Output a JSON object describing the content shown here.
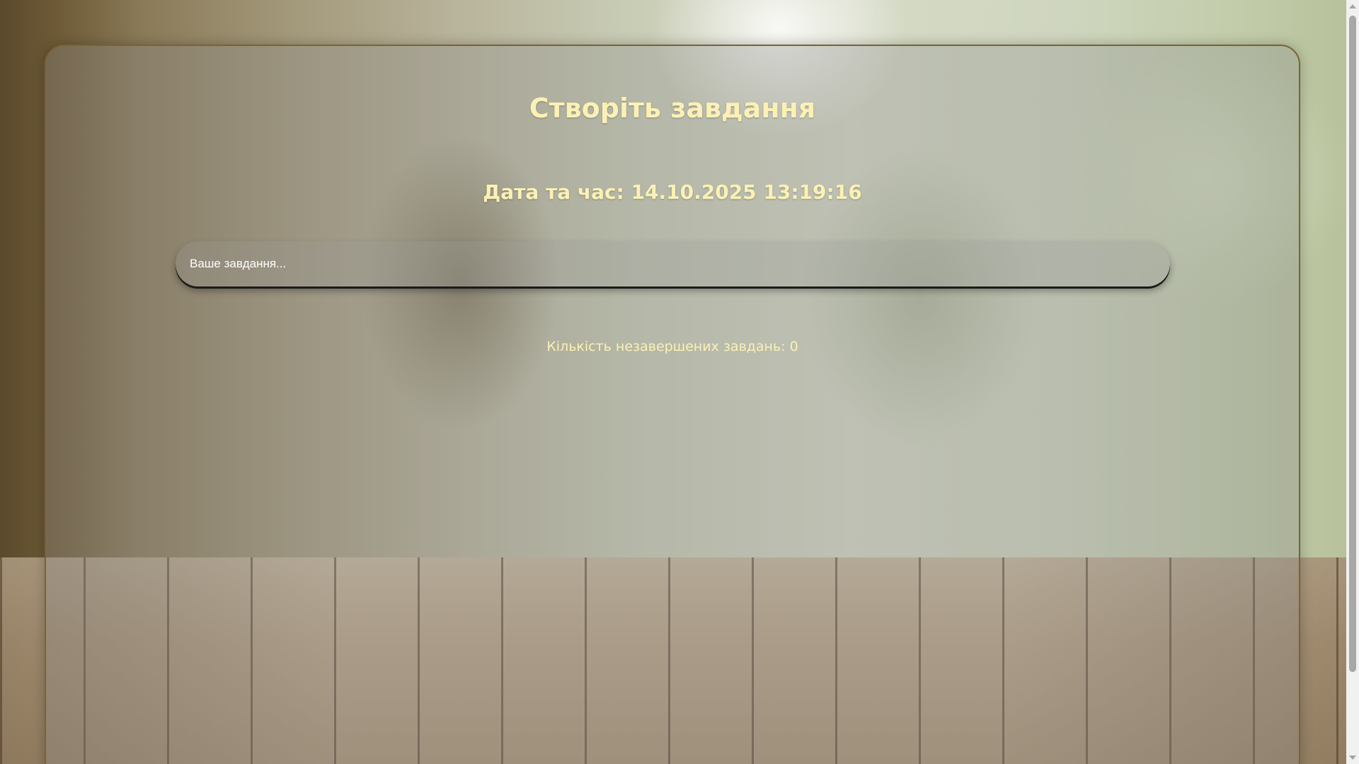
{
  "header": {
    "title": "Створіть завдання"
  },
  "clock": {
    "label": "Дата та час: 14.10.2025 13:19:16"
  },
  "task_form": {
    "placeholder": "Ваше завдання..."
  },
  "stats": {
    "pending_label": "Кількість незавершених завдань: 0"
  },
  "colors": {
    "accent_text": "#fbf1b4",
    "card_border": "#7a6330"
  }
}
